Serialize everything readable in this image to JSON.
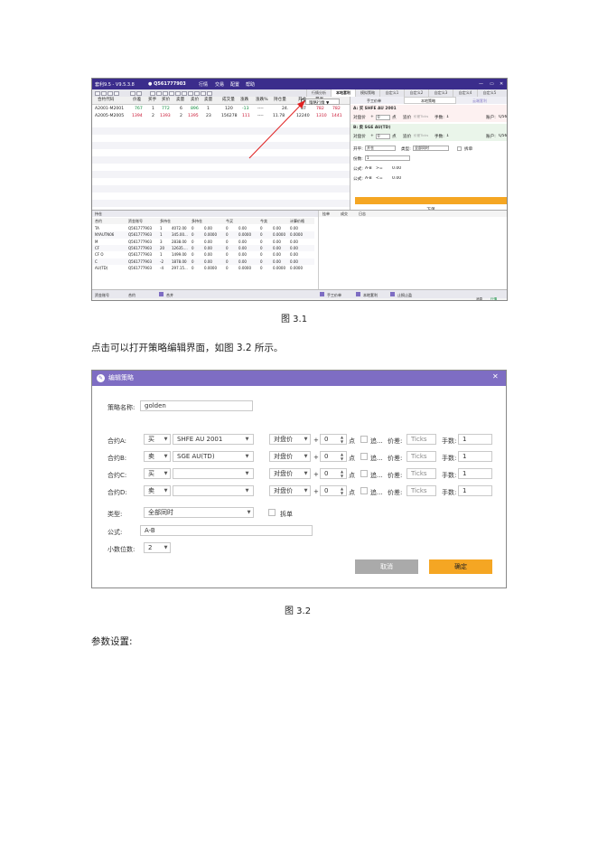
{
  "figure1": {
    "title": "套利9.5 - V9.5.3.8",
    "user": "Q561777903",
    "menu": [
      "行情",
      "交易",
      "配置",
      "帮助"
    ],
    "window_controls": [
      "—",
      "▭",
      "✕"
    ],
    "right_tabs": [
      "行情分析",
      "本地套利",
      "模拟策略",
      "自定义1",
      "自定义2",
      "自定义3",
      "自定义4",
      "自定义5"
    ],
    "strategy_dropdown": "策略行情 ▼",
    "right_subtabs": [
      "手工价单",
      "本地策略",
      "云端套利"
    ],
    "table_headers": [
      "合约代码",
      "价差",
      "买手",
      "买价",
      "卖量",
      "卖价",
      "卖量",
      "成交量",
      "涨跌",
      "涨跌%",
      "持仓量",
      "开仓",
      "最高"
    ],
    "rows": [
      {
        "code": "A2001-M2001",
        "cells": [
          "767",
          "1",
          "772",
          "6",
          "896",
          "1",
          "120",
          "-13",
          "----",
          "24.",
          "87",
          "782",
          "782"
        ]
      },
      {
        "code": "A2005-M2005",
        "cells": [
          "1394",
          "2",
          "1393",
          "2",
          "1395",
          "23",
          "156278",
          "111",
          "----",
          "11.78",
          "12240",
          "1310",
          "1441"
        ]
      }
    ],
    "panel_a": {
      "title": "A: 买 SHFE AU 2001",
      "price_label": "对盘价",
      "plus": "+",
      "offset": "0",
      "points": "点",
      "chase": "追价",
      "tick_hint": "价差Ticks",
      "lots_label": "手数:",
      "lots": "1",
      "account_label": "账户:",
      "account": "Q56"
    },
    "panel_b": {
      "title": "B: 卖 SGE AU(TD)",
      "price_label": "对盘价",
      "plus": "+",
      "offset": "0",
      "points": "点",
      "chase": "追价",
      "tick_hint": "价差Ticks",
      "lots_label": "手数:",
      "lots": "1",
      "account_label": "账户:",
      "account": "Q56"
    },
    "open_close_label": "开平:",
    "open_close": "开仓",
    "type_label": "类型:",
    "type": "全部同时",
    "split_label": "拆单",
    "count_label": "份数:",
    "count": "1",
    "formula1_label": "公式:",
    "formula1": "A-B",
    "formula1_op": ">=",
    "formula1_val": "0.00",
    "formula2_label": "公式:",
    "formula2": "A-B",
    "formula2_op": "<=",
    "formula2_val": "0.00",
    "order_button": "下单",
    "bottom_tab": "持仓",
    "bottom_headers": [
      "合约",
      "资金账号",
      "多持仓",
      "多持仓",
      "今买",
      "今卖",
      "计算价格"
    ],
    "bottom_rows": [
      [
        "TA",
        "Q561777903",
        "1",
        "4072.00",
        "0",
        "0.00",
        "0",
        "0.00",
        "0",
        "0.00",
        "0.00"
      ],
      [
        "NYAUTN06",
        "Q561777903",
        "1",
        "345.00...",
        "0",
        "0.0000",
        "0",
        "0.0000",
        "0",
        "0.0000",
        "0.0000"
      ],
      [
        "M",
        "Q561777903",
        "3",
        "2838.00",
        "0",
        "0.00",
        "0",
        "0.00",
        "0",
        "0.00",
        "0.00"
      ],
      [
        "CF",
        "Q561777903",
        "20",
        "12635....",
        "0",
        "0.00",
        "0",
        "0.00",
        "0",
        "0.00",
        "0.00"
      ],
      [
        "CF O",
        "Q561777903",
        "1",
        "1499.00",
        "0",
        "0.00",
        "0",
        "0.00",
        "0",
        "0.00",
        "0.00"
      ],
      [
        "C",
        "Q561777903",
        "-2",
        "1878.00",
        "0",
        "0.00",
        "0",
        "0.00",
        "0",
        "0.00",
        "0.00"
      ],
      [
        "AU(TD)",
        "Q561777903",
        "-4",
        "297.15...",
        "0",
        "0.0000",
        "0",
        "0.0000",
        "0",
        "0.0000",
        "0.0000"
      ]
    ],
    "bottom_right_tabs": [
      "挂单",
      "成交",
      "日志"
    ],
    "status_left": [
      "资金账号",
      "合约",
      "合并"
    ],
    "status_right": [
      "手工价单",
      "本地套利",
      "止损止盈"
    ],
    "status_far_right": [
      "消息",
      "行情"
    ]
  },
  "caption1": "图 3.1",
  "paragraph1": "点击可以打开策略编辑界面，如图 3.2 所示。",
  "figure2": {
    "title": "编辑策略",
    "close": "✕",
    "name_label": "策略名称:",
    "name_value": "golden",
    "legs": [
      {
        "label": "合约A:",
        "side": "买",
        "contract": "SHFE AU 2001",
        "price": "对盘价",
        "plus": "+",
        "offset": "0",
        "points": "点",
        "chase": "追...",
        "spread_label": "价差:",
        "spread": "Ticks",
        "lots_label": "手数:",
        "lots": "1"
      },
      {
        "label": "合约B:",
        "side": "卖",
        "contract": "SGE AU(TD)",
        "price": "对盘价",
        "plus": "+",
        "offset": "0",
        "points": "点",
        "chase": "追...",
        "spread_label": "价差:",
        "spread": "Ticks",
        "lots_label": "手数:",
        "lots": "1"
      },
      {
        "label": "合约C:",
        "side": "买",
        "contract": "",
        "price": "对盘价",
        "plus": "+",
        "offset": "0",
        "points": "点",
        "chase": "追...",
        "spread_label": "价差:",
        "spread": "Ticks",
        "lots_label": "手数:",
        "lots": "1"
      },
      {
        "label": "合约D:",
        "side": "卖",
        "contract": "",
        "price": "对盘价",
        "plus": "+",
        "offset": "0",
        "points": "点",
        "chase": "追...",
        "spread_label": "价差:",
        "spread": "Ticks",
        "lots_label": "手数:",
        "lots": "1"
      }
    ],
    "type_label": "类型:",
    "type_value": "全部同时",
    "split_label": "拆单",
    "formula_label": "公式:",
    "formula_value": "A-B",
    "decimals_label": "小数位数:",
    "decimals_value": "2",
    "cancel": "取消",
    "ok": "确定"
  },
  "caption2": "图 3.2",
  "paragraph2": "参数设置:",
  "colors": {
    "title_bar": "#3b2d8c",
    "dialog_title": "#7e6dc3",
    "accent": "#f5a623",
    "red": "#c8102e",
    "green": "#0a8a3a"
  }
}
